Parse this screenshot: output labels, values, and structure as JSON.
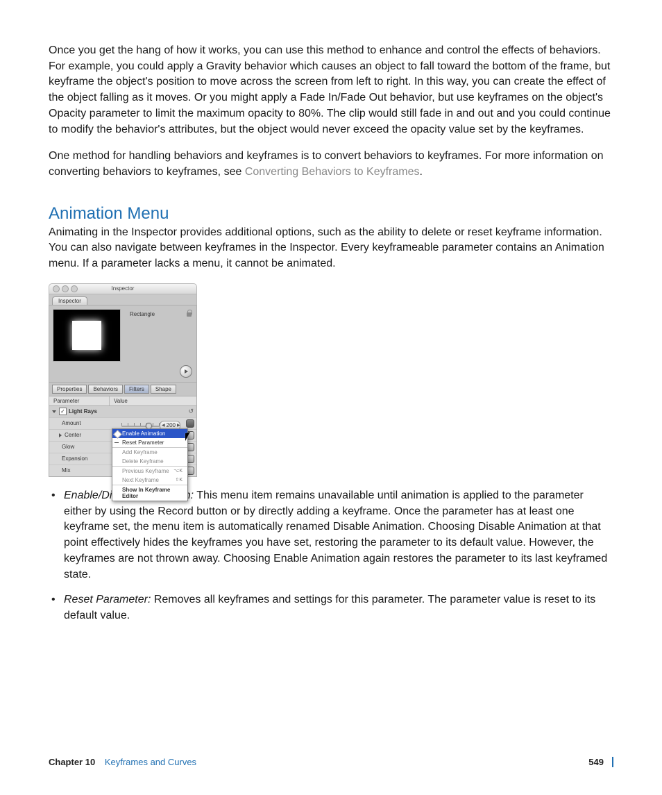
{
  "paragraphs": {
    "p1": "Once you get the hang of how it works, you can use this method to enhance and control the effects of behaviors. For example, you could apply a Gravity behavior which causes an object to fall toward the bottom of the frame, but keyframe the object's position to move across the screen from left to right. In this way, you can create the effect of the object falling as it moves. Or you might apply a Fade In/Fade Out behavior, but use keyframes on the object's Opacity parameter to limit the maximum opacity to 80%. The clip would still fade in and out and you could continue to modify the behavior's attributes, but the object would never exceed the opacity value set by the keyframes.",
    "p2a": "One method for handling behaviors and keyframes is to convert behaviors to keyframes. For more information on converting behaviors to keyframes, see ",
    "p2_link": "Converting Behaviors to Keyframes",
    "p2b": "."
  },
  "heading": "Animation Menu",
  "intro": "Animating in the Inspector provides additional options, such as the ability to delete or reset keyframe information. You can also navigate between keyframes in the Inspector. Every keyframeable parameter contains an Animation menu. If a parameter lacks a menu, it cannot be animated.",
  "inspector": {
    "windowTitle": "Inspector",
    "panelTab": "Inspector",
    "objectName": "Rectangle",
    "segTabs": [
      "Properties",
      "Behaviors",
      "Filters",
      "Shape"
    ],
    "segActiveIndex": 2,
    "colParam": "Parameter",
    "colValue": "Value",
    "group": "Light Rays",
    "rows": {
      "amount": "Amount",
      "amountValue": "200",
      "center": "Center",
      "glow": "Glow",
      "expansion": "Expansion",
      "mix": "Mix"
    },
    "menu": {
      "enable": "Enable Animation",
      "reset": "Reset Parameter",
      "add": "Add Keyframe",
      "delete": "Delete Keyframe",
      "prev": "Previous Keyframe",
      "prevKey": "⌥K",
      "next": "Next Keyframe",
      "nextKey": "⇧K",
      "show": "Show In Keyframe Editor"
    }
  },
  "bullets": {
    "b1_term": "Enable/Disable Animation:",
    "b1_body": "  This menu item remains unavailable until animation is applied to the parameter either by using the Record button or by directly adding a keyframe. Once the parameter has at least one keyframe set, the menu item is automatically renamed Disable Animation. Choosing Disable Animation at that point effectively hides the keyframes you have set, restoring the parameter to its default value. However, the keyframes are not thrown away. Choosing Enable Animation again restores the parameter to its last keyframed state.",
    "b2_term": "Reset Parameter:",
    "b2_body": "  Removes all keyframes and settings for this parameter. The parameter value is reset to its default value."
  },
  "footer": {
    "chapter": "Chapter 10",
    "title": "Keyframes and Curves",
    "page": "549"
  }
}
